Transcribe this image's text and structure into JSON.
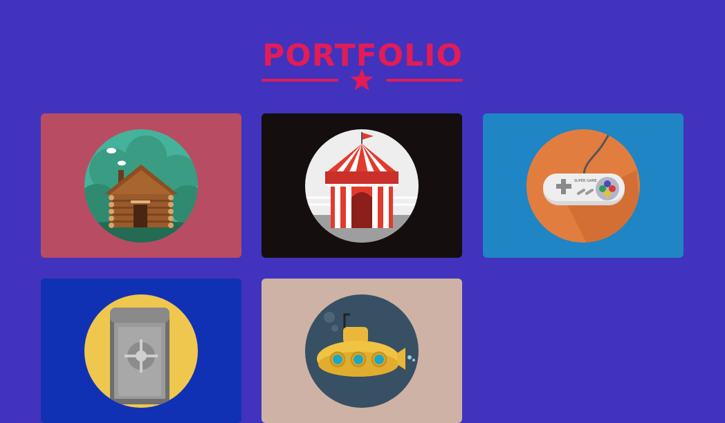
{
  "header": {
    "title": "PORTFOLIO",
    "divider_icon": "star-icon"
  },
  "colors": {
    "background": "#4133bd",
    "accent": "#e11c57"
  },
  "portfolio": {
    "items": [
      {
        "name": "log-cabin",
        "icon": "cabin-icon",
        "bg": "#b84c63"
      },
      {
        "name": "circus-tent",
        "icon": "circus-tent-icon",
        "bg": "#140f0e"
      },
      {
        "name": "game-controller",
        "icon": "game-controller-icon",
        "bg": "#1f85c4",
        "controller_label": "SUPER GAME"
      },
      {
        "name": "safe",
        "icon": "safe-icon",
        "bg": "#1131b5"
      },
      {
        "name": "submarine",
        "icon": "submarine-icon",
        "bg": "#cfb2a6"
      }
    ]
  }
}
